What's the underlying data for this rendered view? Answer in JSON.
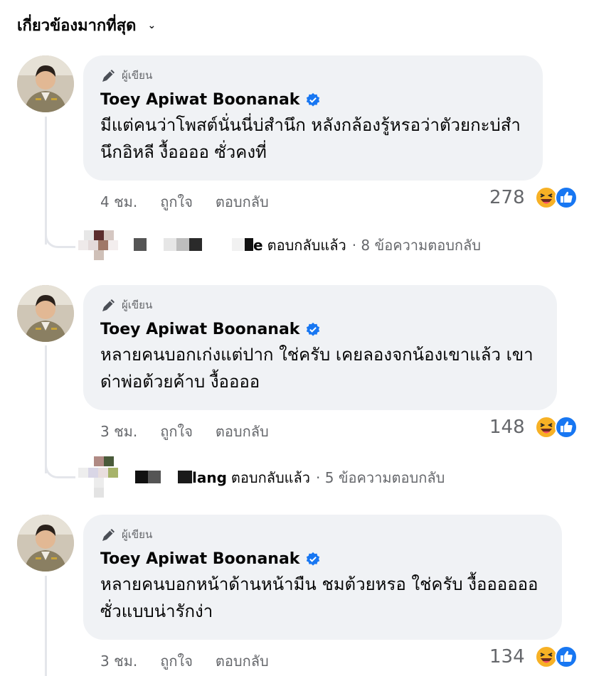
{
  "sort": {
    "label": "เกี่ยวข้องมากที่สุด"
  },
  "comments": [
    {
      "badge": "ผู้เขียน",
      "author": "Toey Apiwat Boonanak",
      "text": "มีแต่คนว่าโพสต์นั่นนี่บ่สำนึก หลังกล้องรู้หรอว่าตัวยกะบ่สำนึกอิหลี งื้ออออ ซั่วคงที่",
      "time": "4 ชม.",
      "like_label": "ถูกใจ",
      "reply_label": "ตอบกลับ",
      "reaction_count": "278",
      "reply_summary": {
        "name_suffix": "e",
        "action": "ตอบกลับแล้ว",
        "meta": "· 8 ข้อความตอบกลับ"
      }
    },
    {
      "badge": "ผู้เขียน",
      "author": "Toey Apiwat Boonanak",
      "text": "หลายคนบอกเก่งแต่ปาก ใช่ครับ เคยลองจกน้องเขาแล้ว เขาด่าพ่อต้วยค้าบ งื้ออออ",
      "time": "3 ชม.",
      "like_label": "ถูกใจ",
      "reply_label": "ตอบกลับ",
      "reaction_count": "148",
      "reply_summary": {
        "name_suffix": "lang",
        "action": "ตอบกลับแล้ว",
        "meta": "· 5 ข้อความตอบกลับ"
      }
    },
    {
      "badge": "ผู้เขียน",
      "author": "Toey Apiwat Boonanak",
      "text": "หลายคนบอกหน้าด้านหน้ามืน ชมต้วยหรอ ใช่ครับ งื้ออออออ ซั่วแบบน่ารักง่า",
      "time": "3 ชม.",
      "like_label": "ถูกใจ",
      "reply_label": "ตอบกลับ",
      "reaction_count": "134"
    }
  ],
  "colors": {
    "verified": "#1877f2",
    "bubble": "#f0f2f5",
    "secondary_text": "#65676b"
  },
  "icons": {
    "badge": "pencil-icon",
    "verified": "verified-badge-icon",
    "reactions": [
      "haha-reaction-icon",
      "like-reaction-icon"
    ]
  }
}
